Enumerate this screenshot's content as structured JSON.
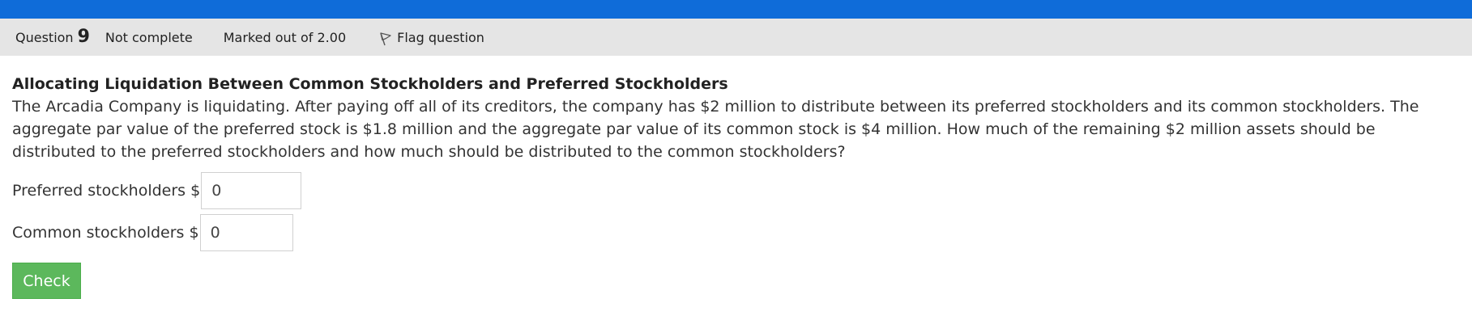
{
  "header": {
    "question_label": "Question",
    "question_number": "9",
    "state": "Not complete",
    "grade": "Marked out of 2.00",
    "flag_label": "Flag question"
  },
  "question": {
    "title": "Allocating Liquidation Between Common Stockholders and Preferred Stockholders",
    "text": "The Arcadia Company is liquidating. After paying off all of its creditors, the company has $2 million to distribute between its preferred stockholders and its common stockholders. The aggregate par value of the preferred stock is $1.8 million and the aggregate par value of its common stock is $4 million. How much of the remaining $2 million assets should be distributed to the preferred stockholders and how much should be distributed to the common stockholders?",
    "fields": [
      {
        "label": "Preferred stockholders $",
        "value": "0"
      },
      {
        "label": "Common stockholders $",
        "value": "0"
      }
    ],
    "check_label": "Check"
  },
  "colors": {
    "topbar": "#0f6cd9",
    "infobar": "#e5e5e5",
    "check_button": "#5cb85c"
  },
  "icons": {
    "flag": "flag-icon"
  }
}
